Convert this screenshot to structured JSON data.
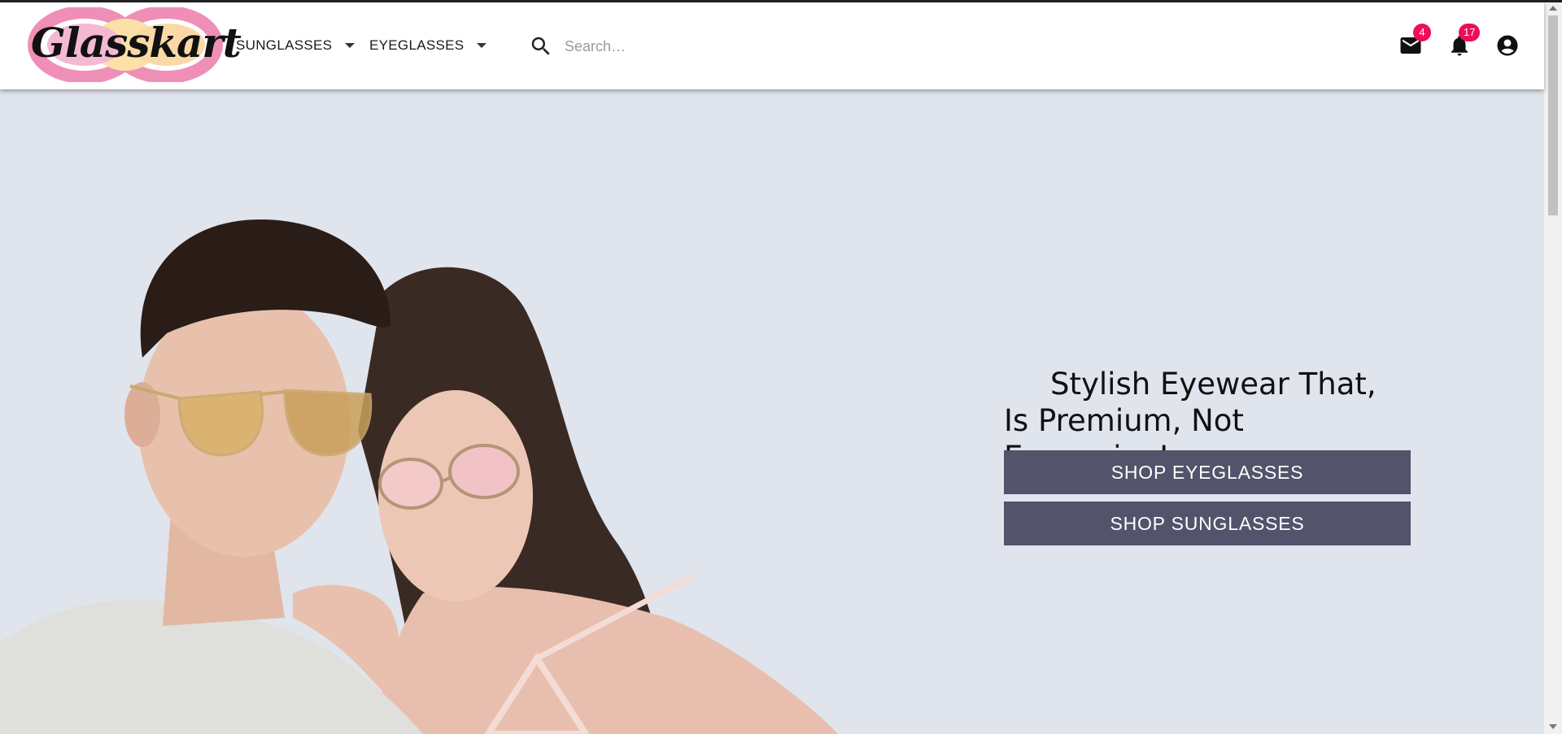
{
  "brand": {
    "logo_text": "Glasskart"
  },
  "nav": {
    "sunglasses_label": "SUNGLASSES",
    "eyeglasses_label": "EYEGLASSES"
  },
  "search": {
    "placeholder": "Search…",
    "icon": "search-icon"
  },
  "header_icons": {
    "mail": {
      "icon": "mail-icon",
      "badge": "4"
    },
    "notifications": {
      "icon": "bell-icon",
      "badge": "17"
    },
    "account": {
      "icon": "account-circle-icon"
    }
  },
  "hero": {
    "tagline_line1": "Stylish Eyewear That,",
    "tagline_line2": "Is Premium, Not Expensive!",
    "shop_eyeglasses_label": "SHOP EYEGLASSES",
    "shop_sunglasses_label": "SHOP SUNGLASSES",
    "image": "man-and-woman-wearing-glasses"
  },
  "colors": {
    "header_bg": "#ffffff",
    "page_bg": "#e0e4ed",
    "button_bg": "#53536b",
    "badge_bg": "#ec0f55"
  }
}
